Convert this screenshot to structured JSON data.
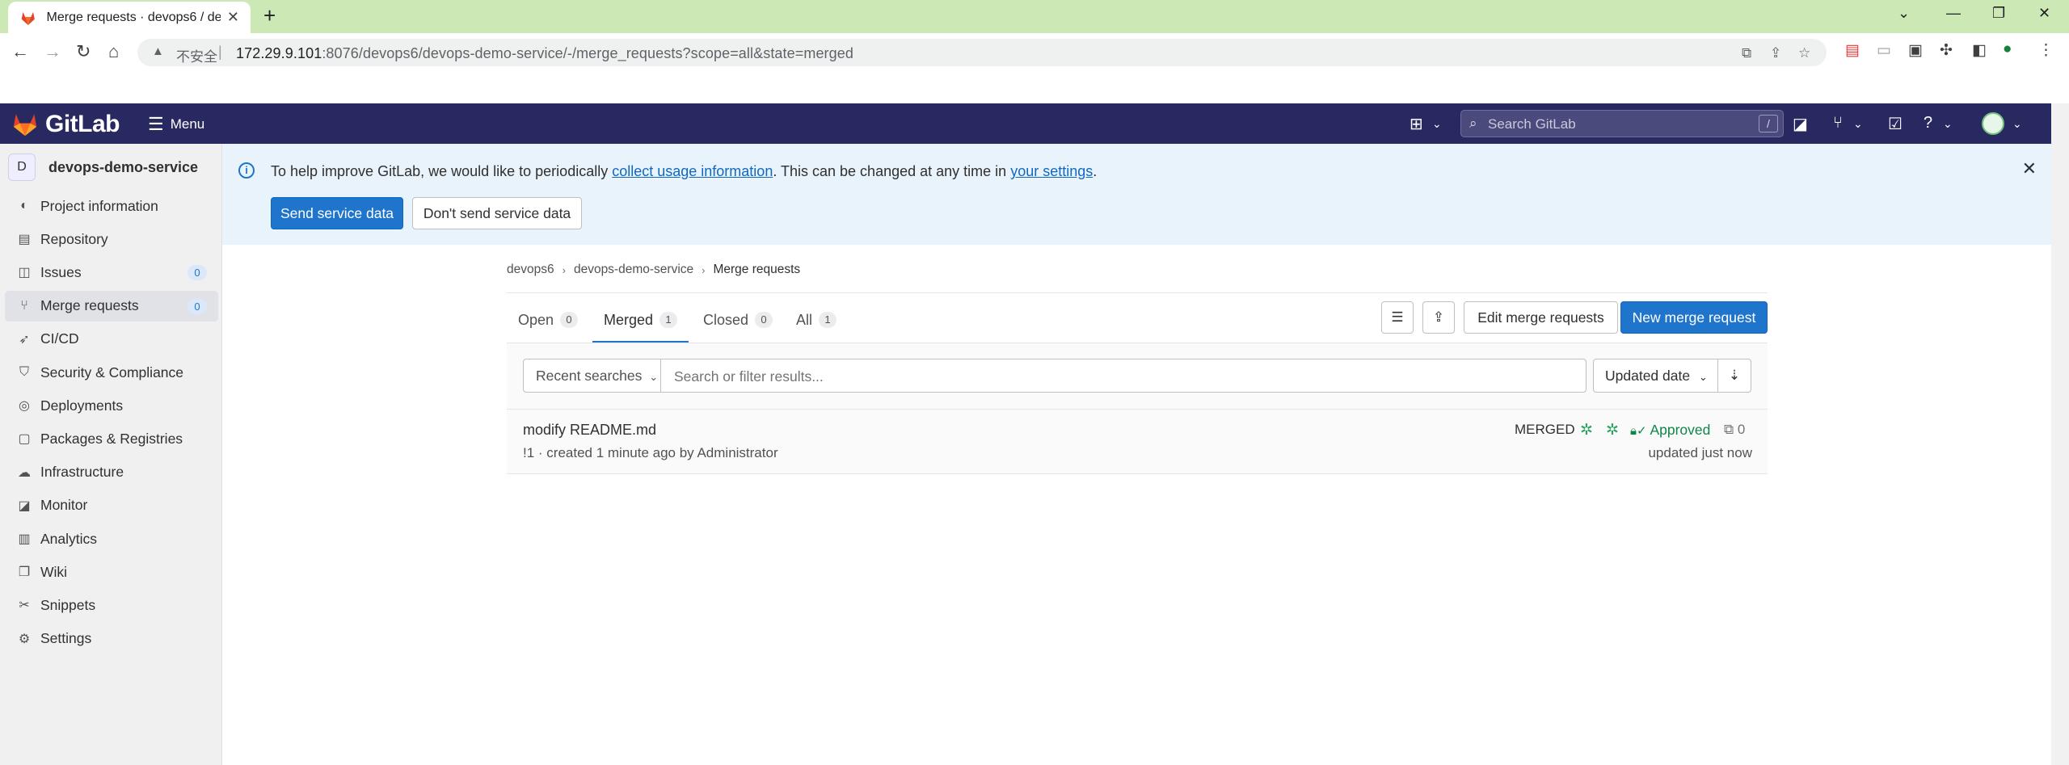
{
  "browser": {
    "tab_title": "Merge requests · devops6 / de",
    "insecure_label": "不安全",
    "url_host": "172.29.9.101",
    "url_rest": ":8076/devops6/devops-demo-service/-/merge_requests?scope=all&state=merged"
  },
  "topnav": {
    "brand": "GitLab",
    "menu_label": "Menu",
    "search_placeholder": "Search GitLab",
    "search_shortcut": "/"
  },
  "sidebar": {
    "project_initial": "D",
    "project_name": "devops-demo-service",
    "items": [
      {
        "label": "Project information",
        "icon": "info-icon"
      },
      {
        "label": "Repository",
        "icon": "repository-icon"
      },
      {
        "label": "Issues",
        "icon": "issues-icon",
        "count": "0"
      },
      {
        "label": "Merge requests",
        "icon": "merge-request-icon",
        "count": "0",
        "active": true
      },
      {
        "label": "CI/CD",
        "icon": "rocket-icon"
      },
      {
        "label": "Security & Compliance",
        "icon": "shield-icon"
      },
      {
        "label": "Deployments",
        "icon": "deployments-icon"
      },
      {
        "label": "Packages & Registries",
        "icon": "package-icon"
      },
      {
        "label": "Infrastructure",
        "icon": "cloud-icon"
      },
      {
        "label": "Monitor",
        "icon": "monitor-icon"
      },
      {
        "label": "Analytics",
        "icon": "chart-icon"
      },
      {
        "label": "Wiki",
        "icon": "book-icon"
      },
      {
        "label": "Snippets",
        "icon": "snippet-icon"
      },
      {
        "label": "Settings",
        "icon": "gear-icon"
      }
    ]
  },
  "banner": {
    "text_before": "To help improve GitLab, we would like to periodically ",
    "link1": "collect usage information",
    "text_middle": ". This can be changed at any time in ",
    "link2": "your settings",
    "text_after": ".",
    "send_button": "Send service data",
    "dont_send_button": "Don't send service data"
  },
  "breadcrumb": {
    "group": "devops6",
    "project": "devops-demo-service",
    "current": "Merge requests"
  },
  "tabs": [
    {
      "label": "Open",
      "count": "0"
    },
    {
      "label": "Merged",
      "count": "1",
      "active": true
    },
    {
      "label": "Closed",
      "count": "0"
    },
    {
      "label": "All",
      "count": "1"
    }
  ],
  "actions": {
    "edit_label": "Edit merge requests",
    "new_label": "New merge request"
  },
  "filter": {
    "recent_searches": "Recent searches",
    "placeholder": "Search or filter results...",
    "sort_label": "Updated date"
  },
  "merge_requests": [
    {
      "title": "modify README.md",
      "meta": "!1 · created 1 minute ago by Administrator",
      "status": "MERGED",
      "approval": "Approved",
      "comments": "0",
      "updated": "updated just now"
    }
  ],
  "colors": {
    "navbar": "#292961",
    "primary": "#1f75cb",
    "approved": "#108548",
    "chrome_tabbar": "#cce8b5"
  }
}
